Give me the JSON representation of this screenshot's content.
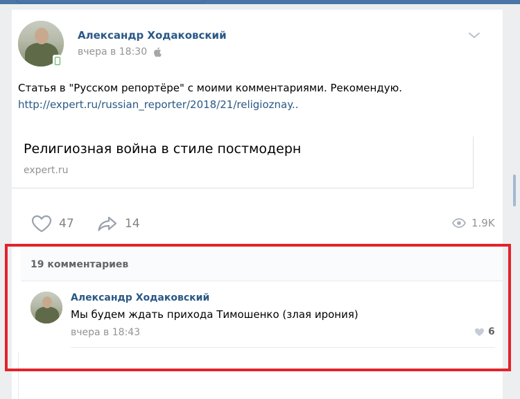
{
  "post": {
    "author": "Александр Ходаковский",
    "time": "вчера в 18:30",
    "text": "Статья в \"Русском репортёре\" с моими комментариями. Рекомендую.",
    "link": "http://expert.ru/russian_reporter/2018/21/religioznay..",
    "snippet": {
      "title": "Религиозная война в стиле постмодерн",
      "domain": "expert.ru"
    },
    "likes": "47",
    "shares": "14",
    "views": "1.9K"
  },
  "comments": {
    "count_label": "19 комментариев",
    "items": [
      {
        "author": "Александр Ходаковский",
        "text": "Мы будем ждать прихода Тимошенко (злая ирония)",
        "time": "вчера в 18:43",
        "likes": "6"
      }
    ]
  },
  "colors": {
    "link": "#2a5885",
    "highlight": "#e2232a",
    "header_bar": "#4a76a8"
  },
  "icons": [
    "apple-icon",
    "chevron-down-icon",
    "heart-icon",
    "share-arrow-icon",
    "eye-icon",
    "online-mobile-icon"
  ]
}
